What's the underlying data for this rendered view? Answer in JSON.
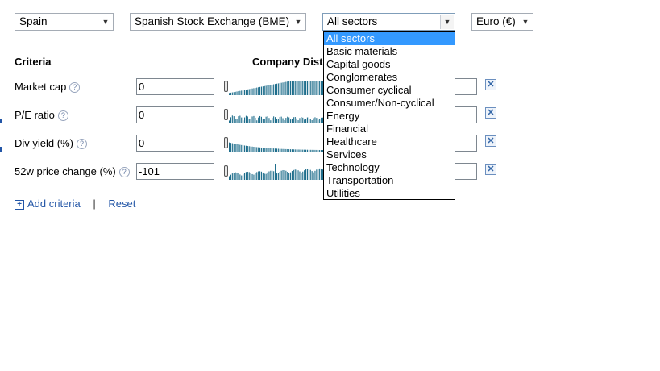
{
  "top": {
    "country": "Spain",
    "exchange": "Spanish Stock Exchange (BME)",
    "sector": "All sectors",
    "currency": "Euro (€)"
  },
  "headers": {
    "criteria": "Criteria",
    "distribution": "Company Dist"
  },
  "help_glyph": "?",
  "remove_glyph": "✕",
  "criteria": [
    {
      "label": "Market cap",
      "min": "0"
    },
    {
      "label": "P/E ratio",
      "min": "0"
    },
    {
      "label": "Div yield (%)",
      "min": "0"
    },
    {
      "label": "52w price change (%)",
      "min": "-101"
    }
  ],
  "links": {
    "add": "Add criteria",
    "separator": "|",
    "reset": "Reset"
  },
  "sector_options": [
    "All sectors",
    "Basic materials",
    "Capital goods",
    "Conglomerates",
    "Consumer cyclical",
    "Consumer/Non-cyclical",
    "Energy",
    "Financial",
    "Healthcare",
    "Services",
    "Technology",
    "Transportation",
    "Utilities"
  ],
  "selected_sector_index": 0,
  "colors": {
    "histogram": "#1f6e8c",
    "link": "#2255a6",
    "highlight": "#3399ff"
  }
}
